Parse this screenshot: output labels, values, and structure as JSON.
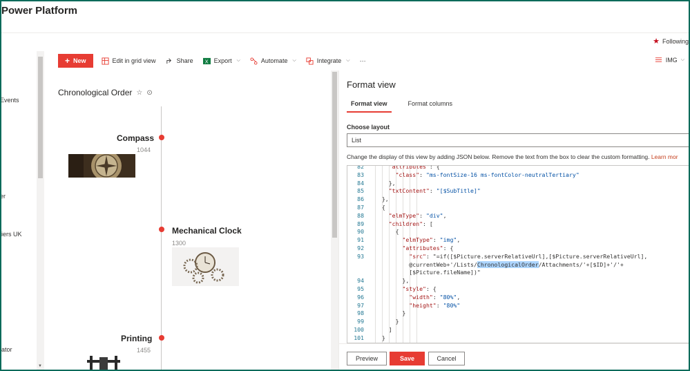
{
  "brand": {
    "title": "Power Platform"
  },
  "following": {
    "label": "Following"
  },
  "leftnav": {
    "items": [
      "Events",
      "er",
      "liers UK",
      "lator"
    ]
  },
  "cmdbar": {
    "new_label": "New",
    "edit_grid_label": "Edit in grid view",
    "share_label": "Share",
    "export_label": "Export",
    "automate_label": "Automate",
    "integrate_label": "Integrate",
    "more_label": "···",
    "view_label": "IMG"
  },
  "list": {
    "title": "Chronological Order",
    "events": [
      {
        "title": "Compass",
        "year": "1044"
      },
      {
        "title": "Mechanical Clock",
        "year": "1300"
      },
      {
        "title": "Printing",
        "year": "1455"
      }
    ]
  },
  "panel": {
    "title": "Format view",
    "tabs": [
      "Format view",
      "Format columns"
    ],
    "layout_label": "Choose layout",
    "layout_value": "List",
    "help_text": "Change the display of this view by adding JSON below. Remove the text from the box to clear the custom formatting.",
    "help_link": "Learn mor",
    "code": [
      {
        "ln": "82",
        "text": "    \"attributes\": {"
      },
      {
        "ln": "83",
        "text": "      \"class\": \"ms-fontSize-16 ms-fontColor-neutralTertiary\""
      },
      {
        "ln": "84",
        "text": "    },"
      },
      {
        "ln": "85",
        "text": "    \"txtContent\": \"[$SubTitle]\""
      },
      {
        "ln": "86",
        "text": "  },"
      },
      {
        "ln": "87",
        "text": "  {"
      },
      {
        "ln": "88",
        "text": "    \"elmType\": \"div\","
      },
      {
        "ln": "89",
        "text": "    \"children\": ["
      },
      {
        "ln": "90",
        "text": "      {"
      },
      {
        "ln": "91",
        "text": "        \"elmType\": \"img\","
      },
      {
        "ln": "92",
        "text": "        \"attributes\": {"
      },
      {
        "ln": "93",
        "text": "          \"src\": \"=if([$Picture.serverRelativeUrl],[$Picture.serverRelativeUrl],"
      },
      {
        "ln": "",
        "text": "          @currentWeb+'/Lists/ChronologicalOrder/Attachments/'+[$ID]+'/'+"
      },
      {
        "ln": "",
        "text": "          [$Picture.fileName])\""
      },
      {
        "ln": "94",
        "text": "        },"
      },
      {
        "ln": "95",
        "text": "        \"style\": {"
      },
      {
        "ln": "96",
        "text": "          \"width\": \"80%\","
      },
      {
        "ln": "97",
        "text": "          \"height\": \"80%\""
      },
      {
        "ln": "98",
        "text": "        }"
      },
      {
        "ln": "99",
        "text": "      }"
      },
      {
        "ln": "100",
        "text": "    ]"
      },
      {
        "ln": "101",
        "text": "  }"
      }
    ],
    "highlight_word": "ChronologicalOrder",
    "buttons": {
      "preview": "Preview",
      "save": "Save",
      "cancel": "Cancel"
    }
  },
  "colors": {
    "accent": "#e73c33",
    "frame": "#0a6b5a"
  }
}
